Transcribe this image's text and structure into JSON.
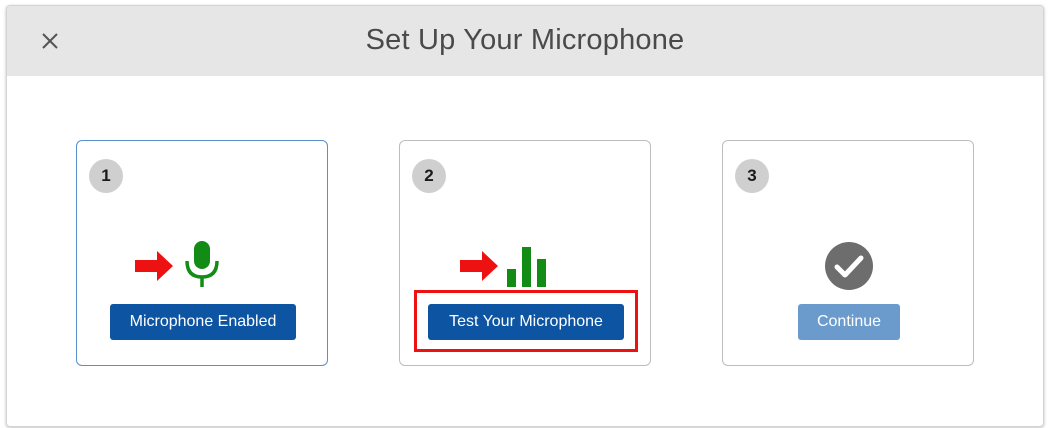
{
  "dialog": {
    "title": "Set Up Your Microphone",
    "close_icon": "close-icon"
  },
  "steps": [
    {
      "number": "1",
      "icons": [
        "red-arrow-icon",
        "microphone-icon"
      ],
      "button_label": "Microphone Enabled",
      "button_enabled": true
    },
    {
      "number": "2",
      "icons": [
        "red-arrow-icon",
        "audio-level-bars-icon"
      ],
      "button_label": "Test Your Microphone",
      "button_enabled": true,
      "highlighted": true
    },
    {
      "number": "3",
      "icons": [
        "checkmark-circle-icon"
      ],
      "button_label": "Continue",
      "button_enabled": false
    }
  ],
  "colors": {
    "header_bg": "#e6e6e6",
    "primary_button": "#0d55a3",
    "disabled_button": "#6a9bcc",
    "icon_green": "#128c14",
    "arrow_red": "#ee1111",
    "check_gray": "#6d6d6d",
    "highlight_border": "#ee1111"
  }
}
